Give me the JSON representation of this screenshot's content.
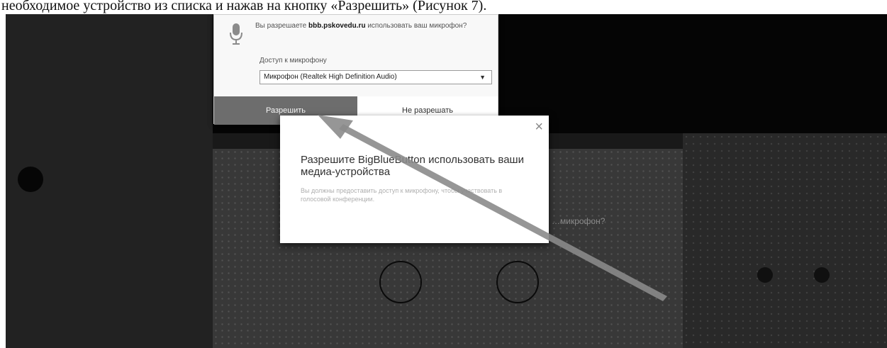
{
  "document": {
    "caption": "необходимое устройство из списка и нажав на кнопку «Разрешить» (Рисунок 7)."
  },
  "browser_permission": {
    "question_prefix": "Вы разрешаете",
    "site": "bbb.pskovedu.ru",
    "question_suffix": "использовать ваш микрофон?",
    "access_label": "Доступ к микрофону",
    "selected_device": "Микрофон (Realtek High Definition Audio)",
    "allow_label": "Разрешить",
    "deny_label": "Не разрешать"
  },
  "bbb_dialog": {
    "close_symbol": "×",
    "title": "Разрешите BigBlueButton использовать ваши медиа-устройства",
    "description": "Вы должны предоставить доступ к микрофону, чтобы участвовать в голосовой конференции."
  },
  "background_app": {
    "mid_question": "…микрофон?"
  },
  "colors": {
    "screen_bg": "#1e1e1e",
    "popup_bg": "#f2f2f2",
    "allow_button": "#6e6e6e",
    "arrow": "#8a8a8a"
  }
}
